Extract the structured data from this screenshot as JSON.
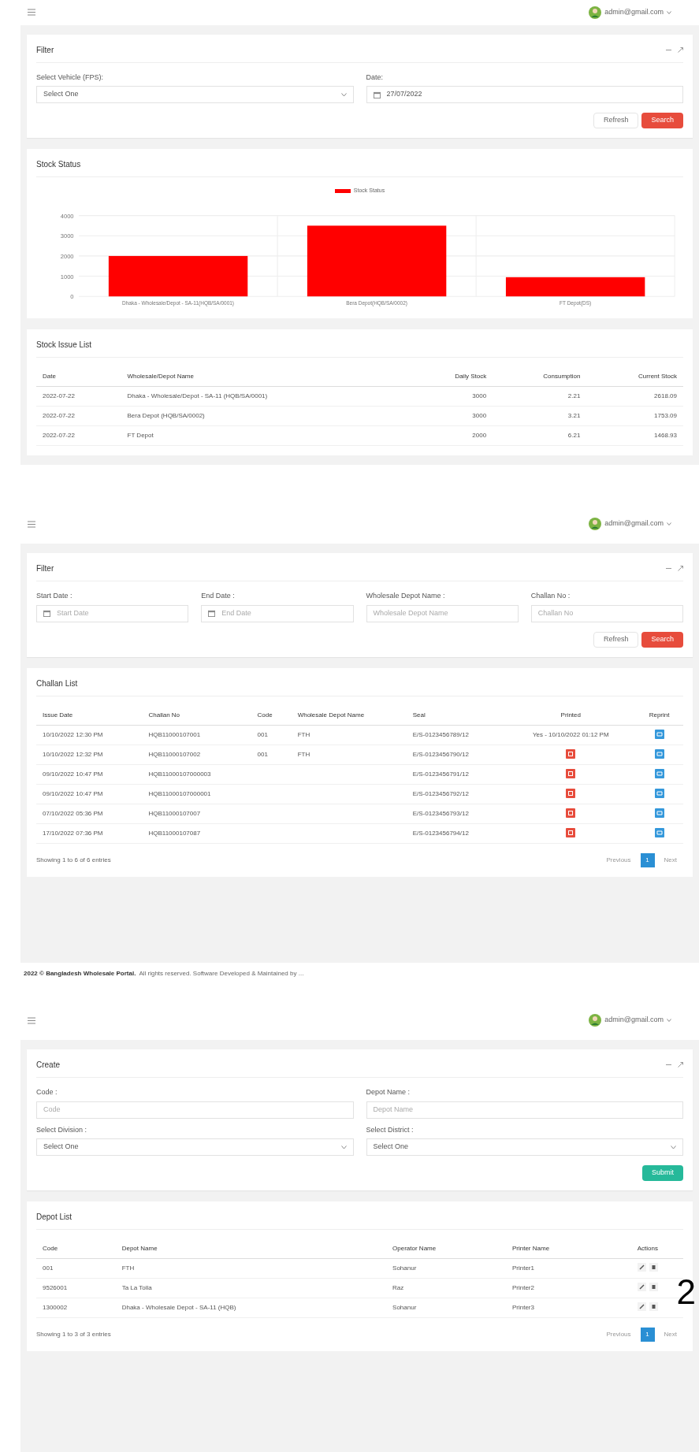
{
  "screens": [
    {
      "user": "admin@gmail.com",
      "cards": [
        {
          "kind": "form",
          "title": "Filter",
          "fields": [
            {
              "label": "Select Vehicle (FPS):",
              "kind": "select",
              "value": "Select One"
            },
            {
              "label": "Date:",
              "kind": "date",
              "value": "27/07/2022"
            }
          ],
          "buttons": [
            {
              "label": "Refresh",
              "kind": "default"
            },
            {
              "label": "Search",
              "kind": "danger"
            }
          ]
        },
        {
          "kind": "chart",
          "title": "Stock Status",
          "chart_data": {
            "type": "bar",
            "categories": [
              "Dhaka - Wholesale/Depot - SA-11(HQB/SA/0001)",
              "Bera Depot(HQB/SA/0002)",
              "FT Depot(DS)"
            ],
            "series": [
              {
                "name": "Stock Status",
                "color": "#ff0000",
                "values": [
                  2000,
                  3500,
                  950
                ]
              }
            ],
            "ylim": [
              0,
              4000
            ],
            "grid": true,
            "yticks": [
              0,
              1000,
              2000,
              3000,
              4000
            ]
          }
        },
        {
          "kind": "table",
          "title": "Stock Issue List",
          "columns": [
            "Date",
            "Wholesale/Depot Name",
            "Daily Stock",
            "Consumption",
            "Current Stock"
          ],
          "rows": [
            [
              "2022-07-22",
              "Dhaka - Wholesale/Depot - SA-11 (HQB/SA/0001)",
              "3000",
              "2.21",
              "2618.09"
            ],
            [
              "2022-07-22",
              "Bera Depot (HQB/SA/0002)",
              "3000",
              "3.21",
              "1753.09"
            ],
            [
              "2022-07-22",
              "FT Depot",
              "2000",
              "6.21",
              "1468.93"
            ]
          ]
        }
      ]
    },
    {
      "user": "admin@gmail.com",
      "cards": [
        {
          "kind": "form",
          "title": "Filter",
          "fields": [
            {
              "label": "Start Date :",
              "kind": "date",
              "placeholder": "Start Date"
            },
            {
              "label": "End Date :",
              "kind": "date",
              "placeholder": "End Date"
            },
            {
              "label": "Wholesale Depot Name :",
              "kind": "text",
              "placeholder": "Wholesale Depot Name"
            },
            {
              "label": "Challan No :",
              "kind": "text",
              "placeholder": "Challan No"
            }
          ],
          "buttons": [
            {
              "label": "Refresh",
              "kind": "default"
            },
            {
              "label": "Search",
              "kind": "danger"
            }
          ]
        },
        {
          "kind": "table",
          "title": "Challan List",
          "columns": [
            "Issue Date",
            "Challan No",
            "Code",
            "Wholesale Depot Name",
            "Seal",
            "Printed",
            "Reprint"
          ],
          "rows": [
            [
              "10/10/2022 12:30 PM",
              "HQB11000107001",
              "001",
              "FTH",
              "E/S-0123456789/12",
              "Yes - 10/10/2022 01:12 PM",
              {
                "kind": "reprint"
              }
            ],
            [
              "10/10/2022 12:32 PM",
              "HQB11000107002",
              "001",
              "FTH",
              "E/S-0123456790/12",
              {
                "kind": "print"
              },
              {
                "kind": "reprint"
              }
            ],
            [
              "09/10/2022 10:47 PM",
              "HQB11000107000003",
              "",
              "",
              "E/S-0123456791/12",
              {
                "kind": "print"
              },
              {
                "kind": "reprint"
              }
            ],
            [
              "09/10/2022 10:47 PM",
              "HQB11000107000001",
              "",
              "",
              "E/S-0123456792/12",
              {
                "kind": "print"
              },
              {
                "kind": "reprint"
              }
            ],
            [
              "07/10/2022 05:36 PM",
              "HQB11000107007",
              "",
              "",
              "E/S-0123456793/12",
              {
                "kind": "print"
              },
              {
                "kind": "reprint"
              }
            ],
            [
              "17/10/2022 07:36 PM",
              "HQB11000107087",
              "",
              "",
              "E/S-0123456794/12",
              {
                "kind": "print"
              },
              {
                "kind": "reprint"
              }
            ]
          ],
          "info": "Showing 1 to 6 of 6 entries",
          "pagination": {
            "previous": "Previous",
            "next": "Next",
            "pages": [
              {
                "label": "1",
                "selected": true
              }
            ]
          }
        }
      ],
      "footer": {
        "brand": "2022 © Bangladesh Wholesale Portal.",
        "rest": "All rights reserved. Software Developed & Maintained by ..."
      }
    },
    {
      "user": "admin@gmail.com",
      "mark": "2",
      "cards": [
        {
          "kind": "form",
          "title": "Create",
          "fields": [
            {
              "label": "Code :",
              "kind": "text",
              "placeholder": "Code"
            },
            {
              "label": "Depot Name :",
              "kind": "text",
              "placeholder": "Depot Name"
            },
            {
              "label": "Select Division :",
              "kind": "select",
              "value": "Select One"
            },
            {
              "label": "Select District :",
              "kind": "select",
              "value": "Select One"
            }
          ],
          "buttons": [
            {
              "label": "Submit",
              "kind": "success"
            }
          ]
        },
        {
          "kind": "table",
          "title": "Depot List",
          "columns": [
            "Code",
            "Depot Name",
            "Operator Name",
            "Printer Name",
            "Actions"
          ],
          "rows": [
            [
              "001",
              "FTH",
              "Sohanur",
              "Printer1",
              {
                "kind": "actions"
              }
            ],
            [
              "9526001",
              "Ta La Tolla",
              "Raz",
              "Printer2",
              {
                "kind": "actions"
              }
            ],
            [
              "1300002",
              "Dhaka - Wholesale Depot - SA-11 (HQB)",
              "Sohanur",
              "Printer3",
              {
                "kind": "actions"
              }
            ]
          ],
          "info": "Showing 1 to 3 of 3 entries",
          "pagination": {
            "previous": "Previous",
            "next": "Next",
            "pages": [
              {
                "label": "1",
                "selected": true
              }
            ]
          }
        }
      ]
    }
  ]
}
